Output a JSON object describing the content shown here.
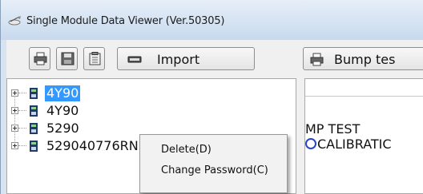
{
  "window": {
    "title": "Single Module Data Viewer (Ver.50305)"
  },
  "toolbar": {
    "print_icon": "printer-icon",
    "save_icon": "floppy-disk-icon",
    "clipboard_icon": "clipboard-icon",
    "import_label": "Import",
    "bump_label": "Bump tes"
  },
  "tree": {
    "items": [
      {
        "label": "4Y90",
        "selected": true
      },
      {
        "label": "4Y90",
        "selected": false
      },
      {
        "label": "5290",
        "selected": false
      },
      {
        "label": "529040776RN",
        "selected": false
      }
    ]
  },
  "right_panel": {
    "line1": "MP TEST",
    "line2": "CALIBRATIC"
  },
  "context_menu": {
    "items": [
      {
        "label": "Delete(D)"
      },
      {
        "label": "Change Password(C)"
      }
    ]
  },
  "colors": {
    "selection": "#3399ff",
    "titlebar": "#d4e2f2",
    "accent_blue": "#2a43c9"
  }
}
